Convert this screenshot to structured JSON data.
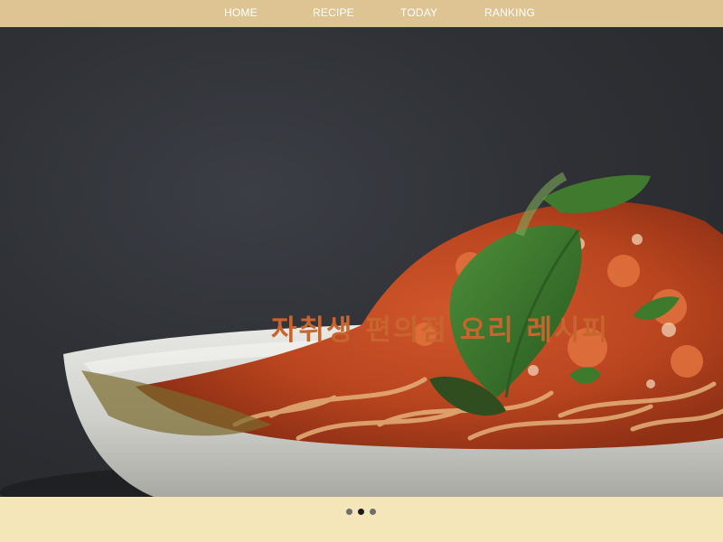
{
  "nav": {
    "items": [
      {
        "label": "HOME"
      },
      {
        "label": "RECIPE"
      },
      {
        "label": "TODAY"
      },
      {
        "label": "RANKING"
      }
    ]
  },
  "hero": {
    "title": "자취생 편의점 요리 레시피",
    "image_subject": "spaghetti-with-tomato-sauce-and-basil"
  },
  "carousel": {
    "slide_count": 3,
    "active_index": 1
  },
  "colors": {
    "nav_bg": "#dec493",
    "nav_text": "#ffffff",
    "hero_bg": "#2f3136",
    "title": "#c6652e",
    "footer_bg": "#f4e6b8",
    "dot": "#6e6e6e",
    "dot_active": "#1c1c1c"
  }
}
